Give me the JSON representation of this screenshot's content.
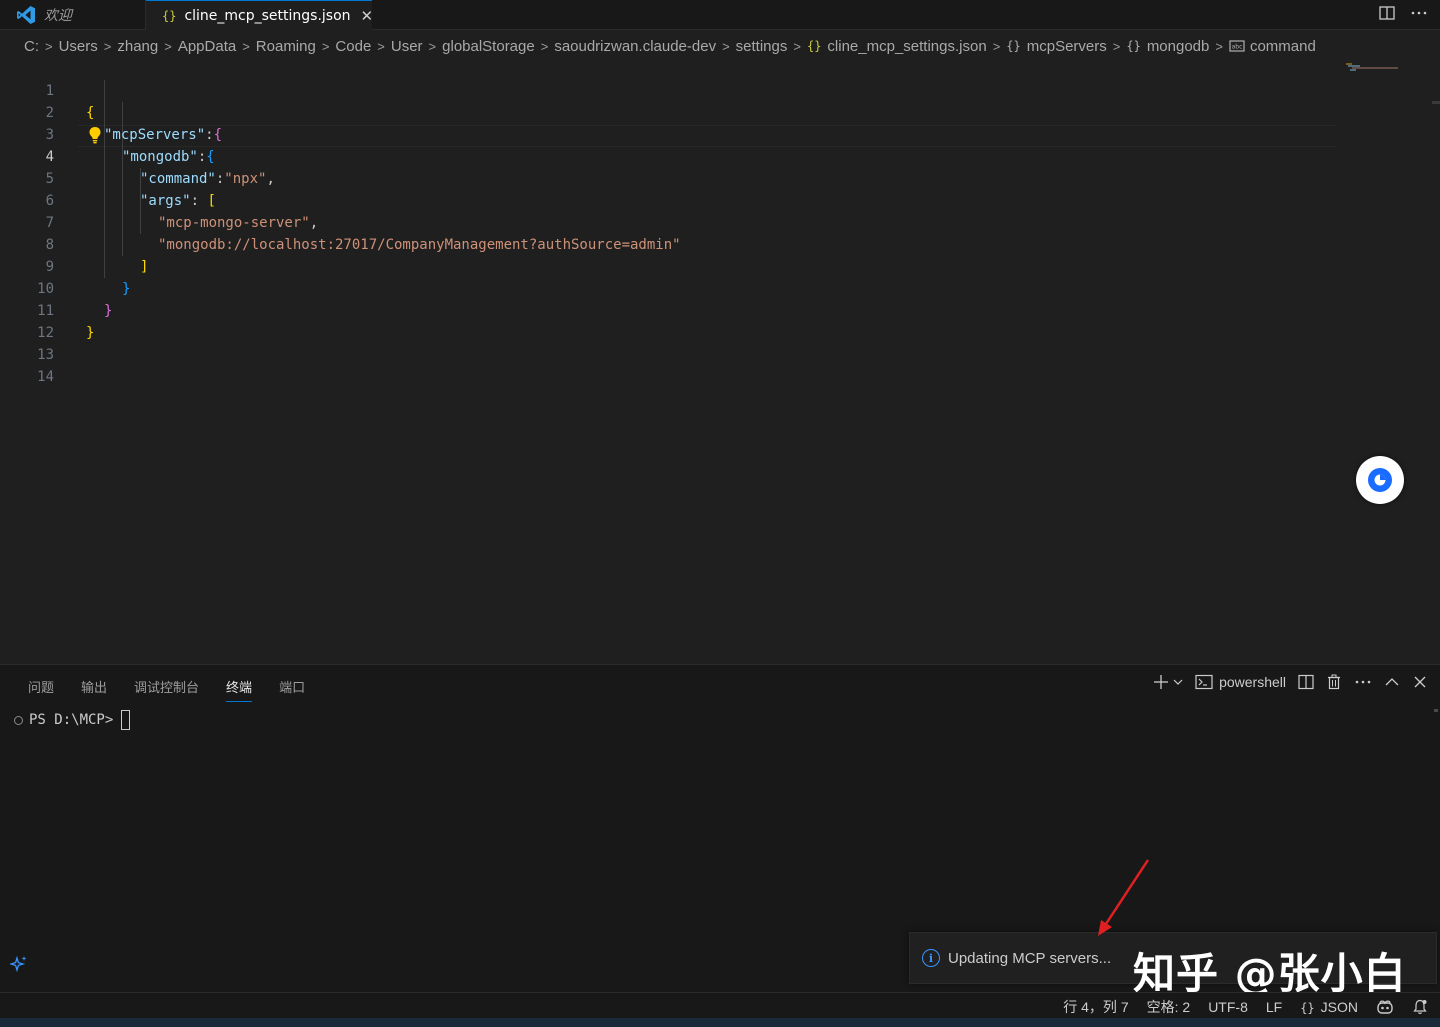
{
  "tabs": {
    "welcome": "欢迎",
    "file": "cline_mcp_settings.json",
    "json_icon": "{}",
    "close": "✕"
  },
  "breadcrumb": [
    "C:",
    "Users",
    "zhang",
    "AppData",
    "Roaming",
    "Code",
    "User",
    "globalStorage",
    "saoudrizwan.claude-dev",
    "settings",
    "cline_mcp_settings.json",
    "mcpServers",
    "mongodb",
    "command"
  ],
  "editor": {
    "line_numbers": [
      "1",
      "2",
      "3",
      "4",
      "5",
      "6",
      "7",
      "8",
      "9",
      "10",
      "11",
      "12",
      "13",
      "14"
    ],
    "current_line": "4",
    "code": {
      "l1": "{",
      "l2_key": "\"mcpServers\"",
      "l2_rest": ":",
      "l2_brace": "{",
      "l3_key": "\"mongodb\"",
      "l3_rest": ":",
      "l3_brace": "{",
      "l4_key": "\"command\"",
      "l4_colon": ":",
      "l4_val": "\"npx\"",
      "l4_comma": ",",
      "l5_key": "\"args\"",
      "l5_colon": ": ",
      "l5_bracket": "[",
      "l6_val": "\"mcp-mongo-server\"",
      "l6_comma": ",",
      "l7_val": "\"mongodb://localhost:27017/CompanyManagement?authSource=admin\"",
      "l8": "]",
      "l9": "}",
      "l10": "}",
      "l11": "}"
    }
  },
  "panel": {
    "tabs": [
      "问题",
      "输出",
      "调试控制台",
      "终端",
      "端口"
    ],
    "active_tab": "终端",
    "shell": "powershell",
    "prompt": "PS D:\\MCP>"
  },
  "notification": {
    "text": "Updating MCP servers..."
  },
  "watermark": "知乎 @张小白",
  "status": {
    "position": "行 4，列 7",
    "spaces": "空格: 2",
    "encoding": "UTF-8",
    "eol": "LF",
    "language": "JSON",
    "language_icon": "{}"
  },
  "colors": {
    "accent": "#0078d4",
    "key": "#9cdcfe",
    "string": "#ce9178",
    "bracket_gold": "#ffd700",
    "bracket_purple": "#da70d6",
    "bracket_blue": "#179fff"
  }
}
